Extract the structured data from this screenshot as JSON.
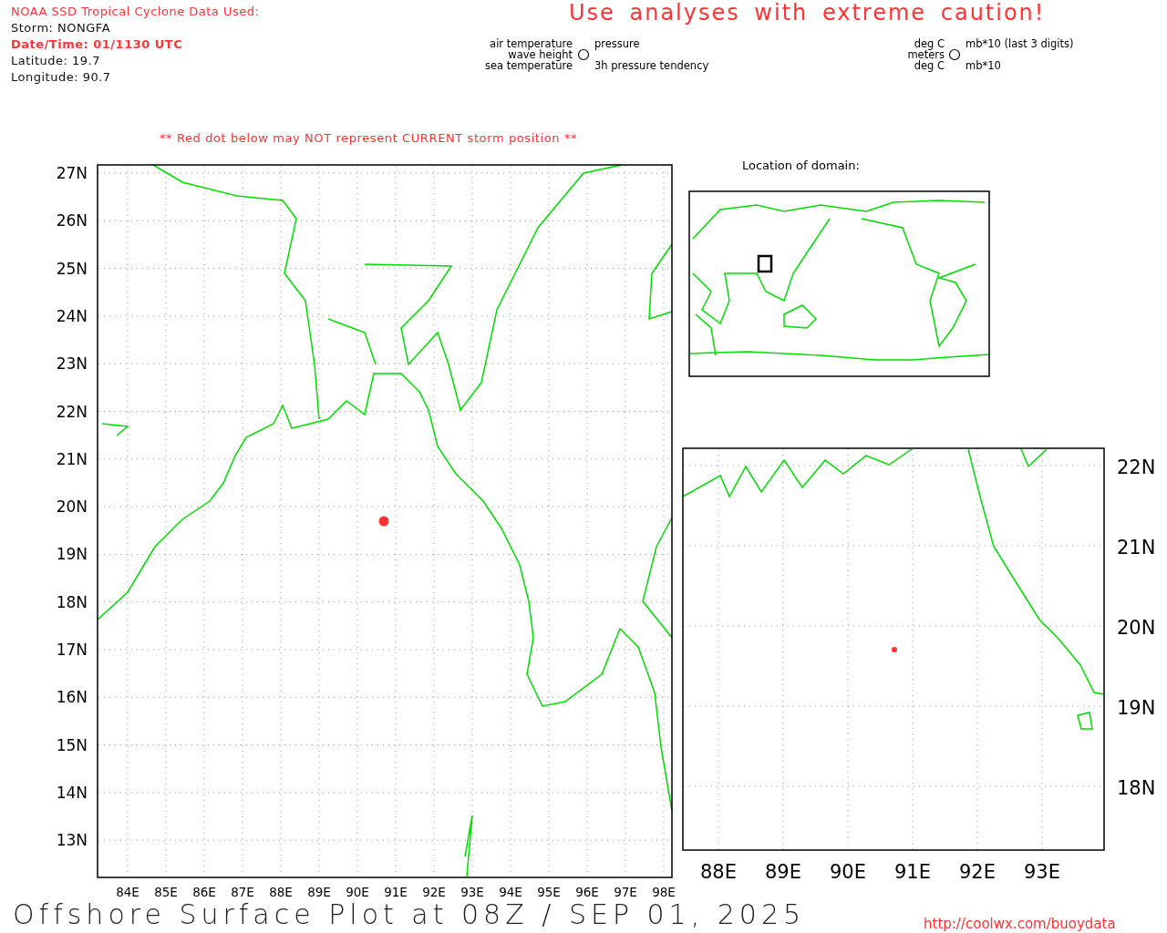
{
  "header": {
    "source": "NOAA SSD Tropical Cyclone Data Used:",
    "storm": "Storm: NONGFA",
    "datetime": "Date/Time: 01/1130 UTC",
    "latitude": "Latitude: 19.7",
    "longitude": "Longitude: 90.7"
  },
  "caution": "Use analyses with extreme caution!",
  "legend_labels": {
    "top_left": "air temperature",
    "mid_left": "wave height",
    "bottom_left": "sea temperature",
    "top_right": "pressure",
    "bottom_right": "3h pressure tendency"
  },
  "legend_units": {
    "top_left": "deg C",
    "mid_left": "meters",
    "bottom_left": "deg C",
    "top_right": "mb*10 (last 3 digits)",
    "bottom_right": "mb*10"
  },
  "warning": "** Red dot below may NOT represent CURRENT storm position **",
  "main_map": {
    "lat_labels": [
      "27N",
      "26N",
      "25N",
      "24N",
      "23N",
      "22N",
      "21N",
      "20N",
      "19N",
      "18N",
      "17N",
      "16N",
      "15N",
      "14N",
      "13N"
    ],
    "lon_labels": [
      "84E",
      "85E",
      "86E",
      "87E",
      "88E",
      "89E",
      "90E",
      "91E",
      "92E",
      "93E",
      "94E",
      "95E",
      "96E",
      "97E",
      "98E"
    ]
  },
  "domain_title": "Location of domain:",
  "zoom_map": {
    "lat_labels": [
      "22N",
      "21N",
      "20N",
      "19N",
      "18N"
    ],
    "lon_labels": [
      "88E",
      "89E",
      "90E",
      "91E",
      "92E",
      "93E"
    ]
  },
  "footer": {
    "title": "Offshore Surface Plot at 08Z / SEP 01, 2025",
    "url": "http://coolwx.com/buoydata"
  }
}
